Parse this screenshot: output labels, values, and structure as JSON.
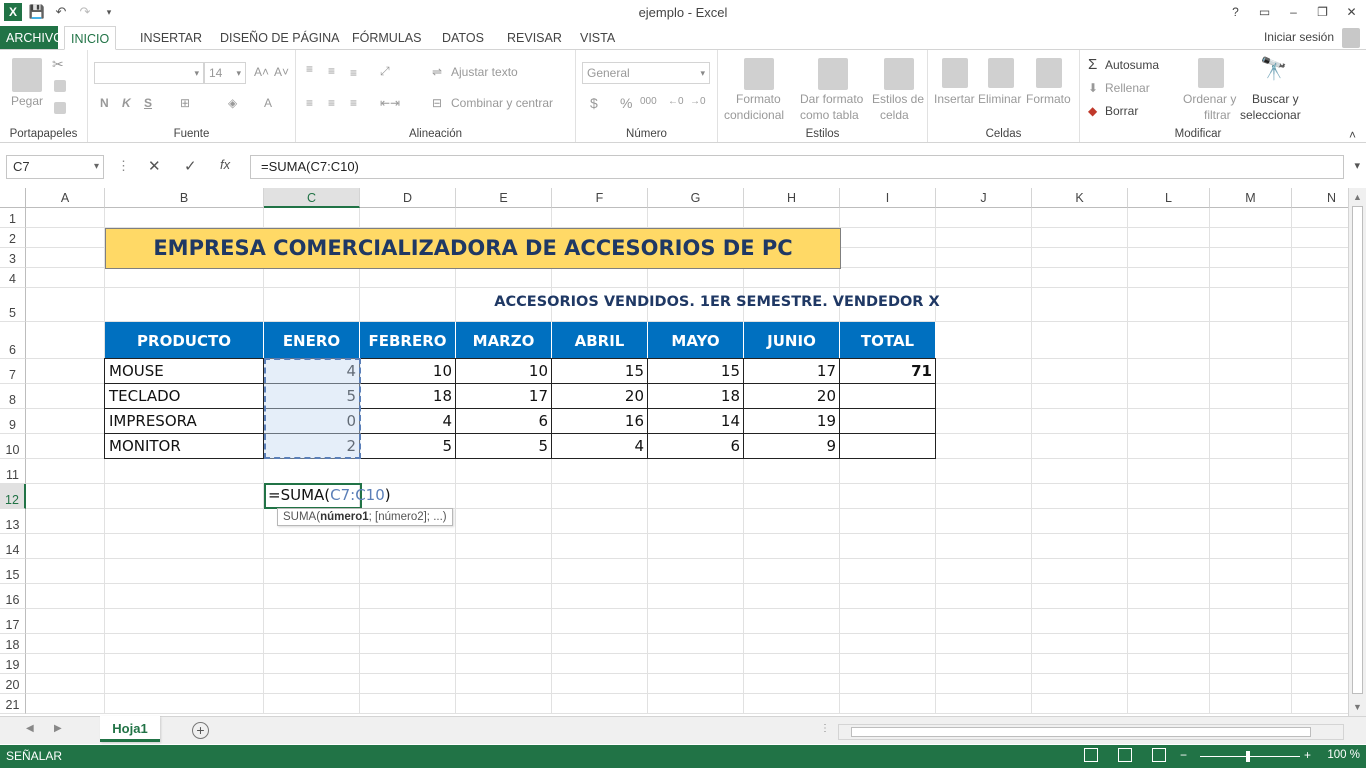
{
  "window": {
    "title": "ejemplo - Excel",
    "controls": [
      "?",
      "▭",
      "–",
      "❐",
      "✕"
    ]
  },
  "tabs": {
    "file": "ARCHIVO",
    "items": [
      "INICIO",
      "INSERTAR",
      "DISEÑO DE PÁGINA",
      "FÓRMULAS",
      "DATOS",
      "REVISAR",
      "VISTA"
    ],
    "active": "INICIO",
    "signin": "Iniciar sesión"
  },
  "ribbon": {
    "clipboard": {
      "paste": "Pegar",
      "label": "Portapapeles"
    },
    "font": {
      "name": "",
      "size": "14",
      "bold": "N",
      "italic": "K",
      "underline": "S",
      "label": "Fuente"
    },
    "alignment": {
      "wrap": "Ajustar texto",
      "merge": "Combinar y centrar",
      "label": "Alineación"
    },
    "number": {
      "format": "General",
      "currency": "$",
      "percent": "%",
      "thousands": "000",
      "label": "Número"
    },
    "styles": {
      "conditional_1": "Formato",
      "conditional_2": "condicional",
      "table_1": "Dar formato",
      "table_2": "como tabla",
      "cell_1": "Estilos de",
      "cell_2": "celda",
      "label": "Estilos"
    },
    "cells": {
      "insert": "Insertar",
      "delete": "Eliminar",
      "format": "Formato",
      "label": "Celdas"
    },
    "editing": {
      "autosum": "Autosuma",
      "fill": "Rellenar",
      "clear": "Borrar",
      "sort_1": "Ordenar y",
      "sort_2": "filtrar",
      "find_1": "Buscar y",
      "find_2": "seleccionar",
      "label": "Modificar"
    }
  },
  "formula_bar": {
    "name_box": "C7",
    "formula": "=SUMA(C7:C10)"
  },
  "columns": [
    "A",
    "B",
    "C",
    "D",
    "E",
    "F",
    "G",
    "H",
    "I",
    "J",
    "K",
    "L",
    "M",
    "N"
  ],
  "rows": [
    "1",
    "2",
    "3",
    "4",
    "5",
    "6",
    "7",
    "8",
    "9",
    "10",
    "11",
    "12",
    "13",
    "14",
    "15",
    "16",
    "17",
    "18",
    "19",
    "20",
    "21"
  ],
  "sheet": {
    "banner": "EMPRESA COMERCIALIZADORA DE ACCESORIOS DE PC",
    "subtitle": "ACCESORIOS VENDIDOS. 1ER SEMESTRE. VENDEDOR X",
    "headers": [
      "PRODUCTO",
      "ENERO",
      "FEBRERO",
      "MARZO",
      "ABRIL",
      "MAYO",
      "JUNIO",
      "TOTAL"
    ],
    "data": [
      [
        "MOUSE",
        "4",
        "10",
        "10",
        "15",
        "15",
        "17",
        "71"
      ],
      [
        "TECLADO",
        "5",
        "18",
        "17",
        "20",
        "18",
        "20",
        ""
      ],
      [
        "IMPRESORA",
        "0",
        "4",
        "6",
        "16",
        "14",
        "19",
        ""
      ],
      [
        "MONITOR",
        "2",
        "5",
        "5",
        "4",
        "6",
        "9",
        ""
      ]
    ],
    "edit": {
      "prefix": "=SUMA(",
      "ref": "C7:C10",
      "suffix": ")"
    },
    "tooltip": {
      "fn": "SUMA(",
      "arg1": "número1",
      "rest": "; [número2]; ...)"
    }
  },
  "sheet_tabs": {
    "active": "Hoja1",
    "add": "+"
  },
  "status": {
    "mode": "SEÑALAR",
    "zoom": "100 %"
  }
}
